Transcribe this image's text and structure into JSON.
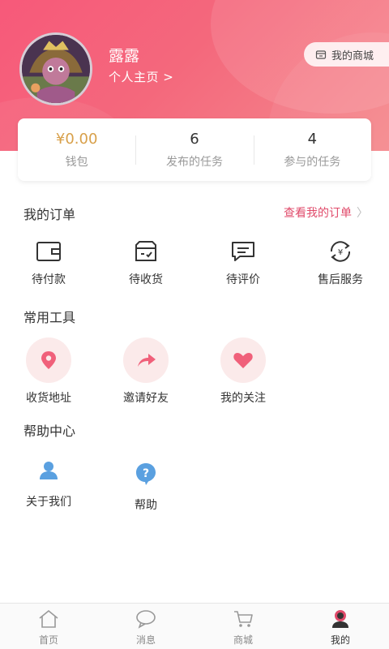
{
  "profile": {
    "username": "露露",
    "homepage_link": "个人主页 >",
    "shop_button": "我的商城"
  },
  "stats": [
    {
      "value": "¥0.00",
      "label": "钱包"
    },
    {
      "value": "6",
      "label": "发布的任务"
    },
    {
      "value": "4",
      "label": "参与的任务"
    }
  ],
  "orders": {
    "title": "我的订单",
    "view_all": "查看我的订单",
    "items": [
      {
        "label": "待付款",
        "icon": "wallet-icon"
      },
      {
        "label": "待收货",
        "icon": "package-icon"
      },
      {
        "label": "待评价",
        "icon": "comment-icon"
      },
      {
        "label": "售后服务",
        "icon": "refund-icon"
      }
    ]
  },
  "tools": {
    "title": "常用工具",
    "items": [
      {
        "label": "收货地址",
        "icon": "location-pin-icon"
      },
      {
        "label": "邀请好友",
        "icon": "share-arrow-icon"
      },
      {
        "label": "我的关注",
        "icon": "heart-icon"
      }
    ]
  },
  "help": {
    "title": "帮助中心",
    "items": [
      {
        "label": "关于我们",
        "icon": "person-icon"
      },
      {
        "label": "帮助",
        "icon": "question-icon"
      }
    ]
  },
  "tabbar": [
    {
      "label": "首页",
      "icon": "home-icon",
      "active": false
    },
    {
      "label": "消息",
      "icon": "message-icon",
      "active": false
    },
    {
      "label": "商城",
      "icon": "cart-icon",
      "active": false
    },
    {
      "label": "我的",
      "icon": "user-icon",
      "active": true
    }
  ],
  "colors": {
    "header_start": "#f7597a",
    "header_end": "#f58a8e",
    "accent": "#e04a6a",
    "wallet_value": "#d8a04a",
    "tool_icon": "#f0607a",
    "help_icon": "#5aa0e0"
  }
}
